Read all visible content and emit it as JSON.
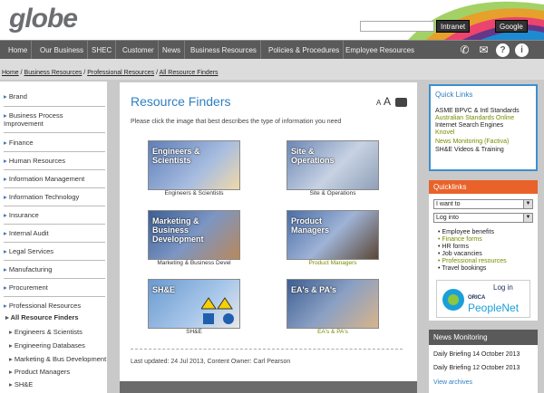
{
  "header": {
    "logo": "globe",
    "search_placeholder": "",
    "search_intranet": "Intranet",
    "search_google": "Google"
  },
  "nav": {
    "items": [
      "Home",
      "Our Business",
      "SHEC",
      "Customer",
      "News",
      "Business Resources",
      "Policies & Procedures",
      "Employee Resources"
    ],
    "icons": [
      "phone-icon",
      "mail-icon",
      "help-icon",
      "info-icon"
    ]
  },
  "breadcrumb": [
    "Home",
    "Business Resources",
    "Professional Resources",
    "All Resource Finders"
  ],
  "sidebar": {
    "items": [
      "Brand",
      "Business Process Improvement",
      "Finance",
      "Human Resources",
      "Information Management",
      "Information Technology",
      "Insurance",
      "Internal Audit",
      "Legal Services",
      "Manufacturing",
      "Procurement",
      "Professional Resources"
    ],
    "current": "All Resource Finders",
    "subitems": [
      "Engineers & Scientists",
      "Engineering Databases",
      "Marketing & Bus Development",
      "Product Managers",
      "SH&E"
    ]
  },
  "main": {
    "title": "Resource Finders",
    "font_small": "A",
    "font_large": "A",
    "intro": "Please click the image that best describes the type of information you need",
    "tiles": [
      {
        "label": "Engineers & Scientists",
        "caption": "Engineers & Scientists"
      },
      {
        "label": "Site & Operations",
        "caption": "Site & Operations"
      },
      {
        "label": "Marketing & Business Development",
        "caption": "Marketing & Business Devel"
      },
      {
        "label": "Product Managers",
        "caption": "Product Managers"
      },
      {
        "label": "SH&E",
        "caption": "SH&E"
      },
      {
        "label": "EA's & PA's",
        "caption": "EA's & PA's"
      }
    ],
    "last_updated": "Last updated: 24 Jul 2013, Content Owner: Carl Pearson"
  },
  "quick_links": {
    "title": "Quick Links",
    "items": [
      "ASME BPVC & Intl Standards",
      "Australian Standards Online",
      "Internet Search Engines",
      "Knovel",
      "News Monitoring (Factiva)",
      "SH&E Videos & Training"
    ],
    "colors": [
      "#222222",
      "#7a8b00",
      "#222222",
      "#7a8b00",
      "#7a8b00",
      "#222222"
    ]
  },
  "quicklinks_panel": {
    "title": "Quicklinks",
    "select1": "I want to",
    "select2": "Log into",
    "items": [
      "Employee benefits",
      "Finance forms",
      "HR forms",
      "Job vacancies",
      "Professional resources",
      "Travel bookings"
    ],
    "banner_login": "Log in",
    "banner_brand": "ORICA",
    "banner_text": "PeopleNet"
  },
  "news": {
    "title": "News Monitoring",
    "items": [
      "Daily Briefing 14 October 2013",
      "Daily Briefing 12 October 2013",
      "View archives"
    ]
  }
}
